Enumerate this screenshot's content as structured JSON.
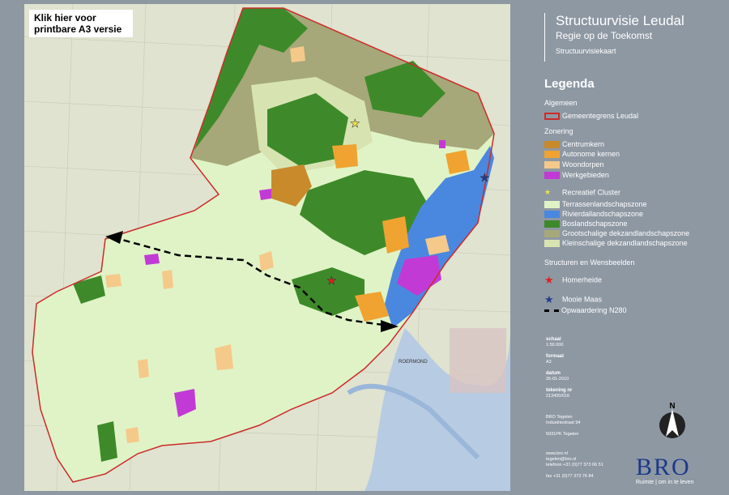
{
  "print_link": "Klik hier voor printbare A3 versie",
  "header": {
    "title": "Structuurvisie Leudal",
    "subtitle": "Regie op de Toekomst",
    "map_type": "Structuurvisiekaart"
  },
  "legend": {
    "heading": "Legenda",
    "sections": {
      "algemeen": "Algemeen",
      "zonering": "Zonering",
      "structuren": "Structuren en Wensbeelden"
    },
    "items": [
      {
        "label": "Gemeentegrens Leudal",
        "color": "#cc2b2b"
      },
      {
        "label": "Centrumkern",
        "color": "#c98a2c"
      },
      {
        "label": "Autonome kernen",
        "color": "#f0a330"
      },
      {
        "label": "Woondorpen",
        "color": "#f5c98a"
      },
      {
        "label": "Werkgebieden",
        "color": "#c23ad6"
      },
      {
        "label": "Recreatief Cluster",
        "color": "#f1e04a"
      },
      {
        "label": "Terrassenlandschapszone",
        "color": "#e0f3c6"
      },
      {
        "label": "Rivierdallandschapszone",
        "color": "#4a88e0"
      },
      {
        "label": "Boslandschapszone",
        "color": "#3e8a2a"
      },
      {
        "label": "Grootschalige dekzandlandschapszone",
        "color": "#a6a879"
      },
      {
        "label": "Kleinschalige dekzandlandschapszone",
        "color": "#d7e4b2"
      },
      {
        "label": "Homerheide",
        "color": "#dd2222"
      },
      {
        "label": "Mooie Maas",
        "color": "#243c8c"
      },
      {
        "label": "Opwaardering N280",
        "color": "#000000"
      }
    ]
  },
  "meta": {
    "schaal_label": "schaal",
    "schaal": "1:50.000",
    "formaat_label": "formaat",
    "formaat": "A3",
    "datum_label": "datum",
    "datum": "26-01-2010",
    "tekening_label": "tekening nr",
    "tekening": "213400/016"
  },
  "address": {
    "name": "BRO Tegelen",
    "street": "Industriestraat 94",
    "city": "5931PK Tegelen"
  },
  "contact": {
    "web": "www.bro.nl",
    "email": "tegelen@bro.nl",
    "phone": "telefoon +31 (0)77 373 06 51",
    "fax": "fax +31 (0)77 373 76 84"
  },
  "north": "N",
  "logo": {
    "text": "BRO",
    "tagline": "Ruimte | om in te leven"
  },
  "map_labels": {
    "roermond": "ROERMOND"
  }
}
